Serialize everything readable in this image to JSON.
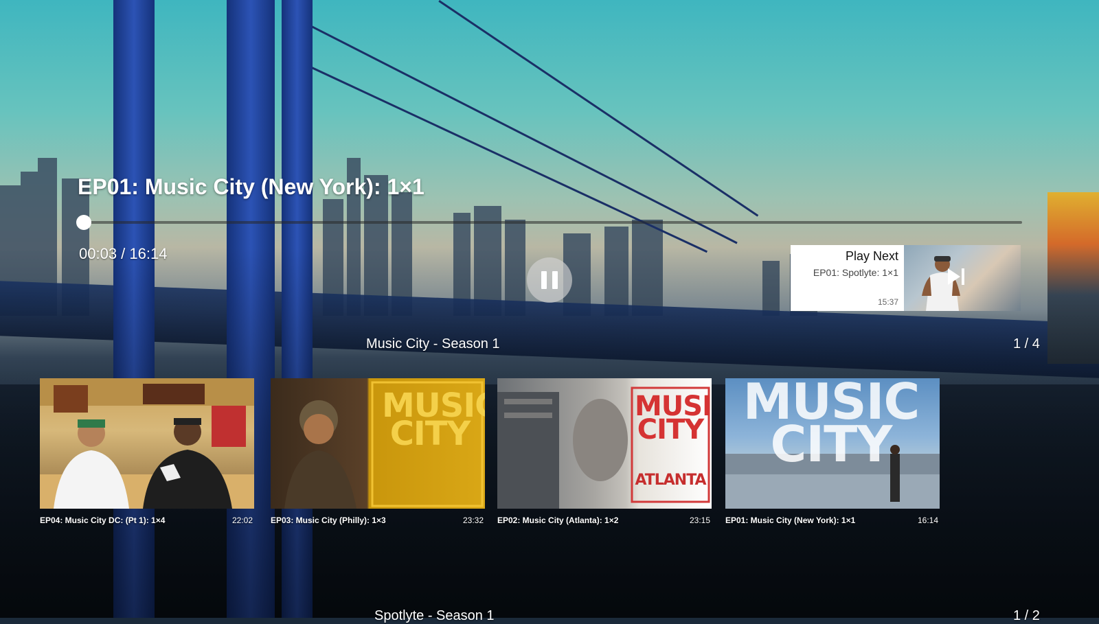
{
  "player": {
    "title": "EP01: Music City (New York): 1×1",
    "time": "00:03 / 16:14",
    "progress": 0.003
  },
  "play_next": {
    "heading": "Play Next",
    "episode": "EP01: Spotlyte: 1×1",
    "duration": "15:37"
  },
  "rows": [
    {
      "title": "Music City - Season 1",
      "count": "1 / 4",
      "items": [
        {
          "label": "EP04: Music City DC: (Pt 1): 1×4",
          "duration": "22:02"
        },
        {
          "label": "EP03: Music City (Philly): 1×3",
          "duration": "23:32"
        },
        {
          "label": "EP02: Music City (Atlanta): 1×2",
          "duration": "23:15"
        },
        {
          "label": "EP01: Music City (New York): 1×1",
          "duration": "16:14"
        }
      ]
    },
    {
      "title": "Spotlyte - Season 1",
      "count": "1 / 2"
    }
  ],
  "art_text": {
    "philly": "MUSIC CITY",
    "atlanta_top": "MUSIC CITY",
    "atlanta_bottom": "ATLANTA",
    "ny": "MUSIC CITY"
  },
  "colors": {
    "accent": "#ffffff",
    "track": "#282828"
  },
  "icons": {
    "pause": "pause-icon",
    "play_next": "skip-next-icon"
  }
}
